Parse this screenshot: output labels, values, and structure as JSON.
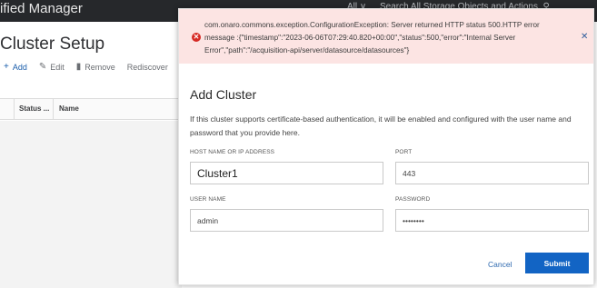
{
  "header": {
    "app_title": "ified Manager",
    "scope_label": "All ∨",
    "search_label": "Search All Storage Objects and Actions",
    "search_icon": "search-icon"
  },
  "page": {
    "title": "Cluster Setup",
    "toolbar": {
      "add_label": "Add",
      "edit_label": "Edit",
      "remove_label": "Remove",
      "rediscover_label": "Rediscover"
    },
    "grid": {
      "columns": [
        "",
        "Status ...",
        "Name"
      ]
    }
  },
  "modal": {
    "error": {
      "message": "com.onaro.commons.exception.ConfigurationException: Server returned HTTP status 500.HTTP error message :{\"timestamp\":\"2023-06-06T07:29:40.820+00:00\",\"status\":500,\"error\":\"Internal Server Error\",\"path\":\"/acquisition-api/server/datasource/datasources\"}",
      "close_icon": "close-icon"
    },
    "title": "Add Cluster",
    "description": "If this cluster supports certificate-based authentication, it will be enabled and configured with the user name and password that you provide here.",
    "fields": {
      "host": {
        "label": "HOST NAME OR IP ADDRESS",
        "value": "Cluster1"
      },
      "port": {
        "label": "PORT",
        "value": "443"
      },
      "user": {
        "label": "USER NAME",
        "value": "admin"
      },
      "password": {
        "label": "PASSWORD",
        "value": "••••••••"
      }
    },
    "cancel_label": "Cancel",
    "submit_label": "Submit"
  },
  "colors": {
    "header_bg": "#26282b",
    "error_bg": "#fce4e3",
    "error_icon": "#d62a24",
    "primary": "#1264c4",
    "link": "#2f6ab0"
  }
}
